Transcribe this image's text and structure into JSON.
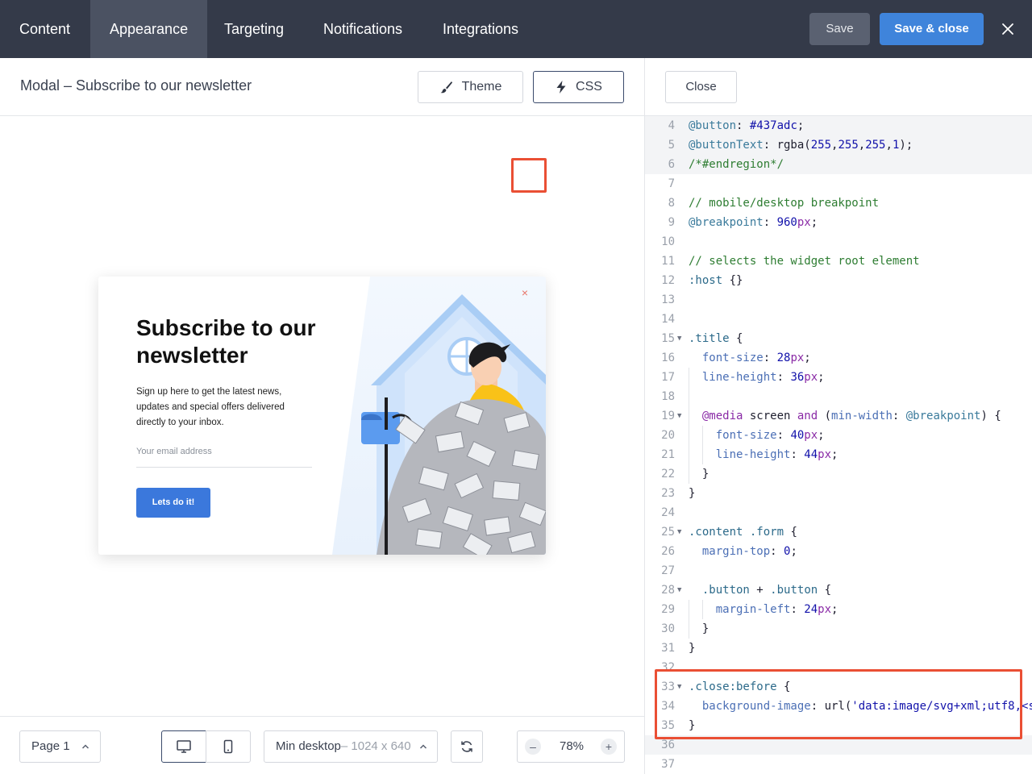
{
  "nav": {
    "tabs": [
      "Content",
      "Appearance",
      "Targeting",
      "Notifications",
      "Integrations"
    ],
    "active_tab": "Appearance",
    "save_label": "Save",
    "save_close_label": "Save & close"
  },
  "header": {
    "page_title": "Modal – Subscribe to our newsletter",
    "theme_label": "Theme",
    "css_label": "CSS"
  },
  "modal": {
    "title": "Subscribe to our newsletter",
    "text": "Sign up here to get the latest news, updates and special offers delivered directly to your inbox.",
    "email_placeholder": "Your email address",
    "button_label": "Lets do it!",
    "close_glyph": "×"
  },
  "bottombar": {
    "page_label": "Page 1",
    "size_label": "Min desktop",
    "size_value": "– 1024 x 640",
    "zoom": "78%",
    "zoom_minus": "–",
    "zoom_plus": "+"
  },
  "editor": {
    "close_label": "Close",
    "lines": [
      {
        "n": "4",
        "text": "@button: #437adc;"
      },
      {
        "n": "5",
        "text": "@buttonText: rgba(255,255,255,1);"
      },
      {
        "n": "6",
        "text": "/*#endregion*/"
      },
      {
        "n": "7",
        "text": ""
      },
      {
        "n": "8",
        "text": "// mobile/desktop breakpoint"
      },
      {
        "n": "9",
        "text": "@breakpoint: 960px;"
      },
      {
        "n": "10",
        "text": ""
      },
      {
        "n": "11",
        "text": "// selects the widget root element"
      },
      {
        "n": "12",
        "text": ":host {}"
      },
      {
        "n": "13",
        "text": ""
      },
      {
        "n": "14",
        "text": ""
      },
      {
        "n": "15",
        "text": ".title {"
      },
      {
        "n": "16",
        "text": "  font-size: 28px;"
      },
      {
        "n": "17",
        "text": "  line-height: 36px;"
      },
      {
        "n": "18",
        "text": ""
      },
      {
        "n": "19",
        "text": "  @media screen and (min-width: @breakpoint) {"
      },
      {
        "n": "20",
        "text": "    font-size: 40px;"
      },
      {
        "n": "21",
        "text": "    line-height: 44px;"
      },
      {
        "n": "22",
        "text": "  }"
      },
      {
        "n": "23",
        "text": "}"
      },
      {
        "n": "24",
        "text": ""
      },
      {
        "n": "25",
        "text": ".content .form {"
      },
      {
        "n": "26",
        "text": "  margin-top: 0;"
      },
      {
        "n": "27",
        "text": ""
      },
      {
        "n": "28",
        "text": "  .button + .button {"
      },
      {
        "n": "29",
        "text": "    margin-left: 24px;"
      },
      {
        "n": "30",
        "text": "  }"
      },
      {
        "n": "31",
        "text": "}"
      },
      {
        "n": "32",
        "text": ""
      },
      {
        "n": "33",
        "text": ".close:before {"
      },
      {
        "n": "34",
        "text": "  background-image: url('data:image/svg+xml;utf8,<s"
      },
      {
        "n": "35",
        "text": "}"
      },
      {
        "n": "36",
        "text": ""
      },
      {
        "n": "37",
        "text": ""
      }
    ]
  },
  "colors": {
    "topbar": "#343a49",
    "accent": "#3f84db",
    "highlight": "#ea4f34",
    "modal_button": "#3b78dc"
  },
  "icons": [
    "close-icon",
    "brush-icon",
    "lightning-icon",
    "chevron-up-icon",
    "desktop-icon",
    "mobile-icon",
    "rotate-icon",
    "minus-icon",
    "plus-icon"
  ]
}
